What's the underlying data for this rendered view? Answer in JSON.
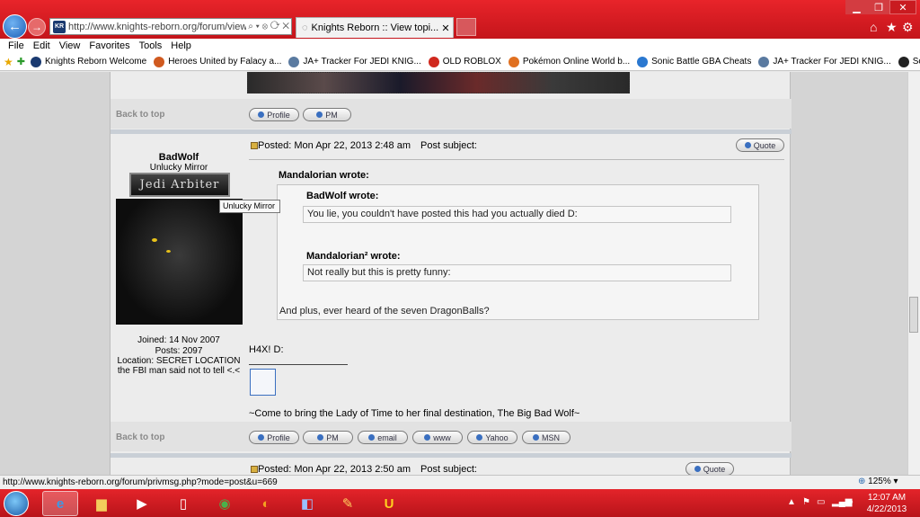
{
  "browser": {
    "address_url": "http://www.knights-reborn.org/forum/viewtopi",
    "address_controls": "⌕ ▾ ⊗ ⟳ ✕",
    "favicon": "KR",
    "tab_title": "Knights Reborn :: View topi...",
    "tab_close": "✕"
  },
  "menu": [
    "File",
    "Edit",
    "View",
    "Favorites",
    "Tools",
    "Help"
  ],
  "favorites": [
    {
      "label": "Knights Reborn Welcome",
      "color": "#1a3a70"
    },
    {
      "label": "Heroes United by Falacy a...",
      "color": "#d05a20"
    },
    {
      "label": "JA+ Tracker For JEDI KNIG...",
      "color": "#5a7aa0"
    },
    {
      "label": "OLD ROBLOX",
      "color": "#d0281e"
    },
    {
      "label": "Pokémon Online World b...",
      "color": "#e07020"
    },
    {
      "label": "Sonic Battle GBA Cheats",
      "color": "#2a78d0"
    },
    {
      "label": "JA+ Tracker For JEDI KNIG...",
      "color": "#5a7aa0"
    },
    {
      "label": "Sonic Wrecks Music",
      "color": "#222222"
    }
  ],
  "posts": {
    "back_to_top": "Back to top",
    "profile_label": "Profile",
    "pm_label": "PM",
    "email_label": "email",
    "www_label": "www",
    "yahoo_label": "Yahoo",
    "msn_label": "MSN",
    "quote_label": "Quote",
    "post1": {
      "author": "BadWolf",
      "rank": "Unlucky Mirror",
      "rank_badge": "Jedi Arbiter",
      "tooltip": "Unlucky Mirror",
      "posted": "Posted: Mon Apr 22, 2013 2:48 am",
      "subject": "Post subject:",
      "joined": "Joined: 14 Nov 2007",
      "posts_count": "Posts: 2097",
      "location": "Location: SECRET LOCATION the FBI man said not to tell <.<",
      "outer_quote_author": "Mandalorian wrote:",
      "inner_quote1_author": "BadWolf wrote:",
      "inner_quote1_text": "You lie, you couldn't have posted this had you actually died D:",
      "inner_quote2_author": "Mandalorian² wrote:",
      "inner_quote2_text": "Not really but this is pretty funny:",
      "outer_quote_text": "And plus, ever heard of the seven DragonBalls?",
      "body": "H4X! D:",
      "signature": "~Come to bring the Lady of Time to her final destination, The Big Bad Wolf~"
    },
    "post2": {
      "posted": "Posted: Mon Apr 22, 2013 2:50 am",
      "subject": "Post subject:"
    }
  },
  "status_url": "http://www.knights-reborn.org/forum/privmsg.php?mode=post&u=669",
  "zoom": "125%",
  "clock": {
    "time": "12:07 AM",
    "date": "4/22/2013"
  }
}
